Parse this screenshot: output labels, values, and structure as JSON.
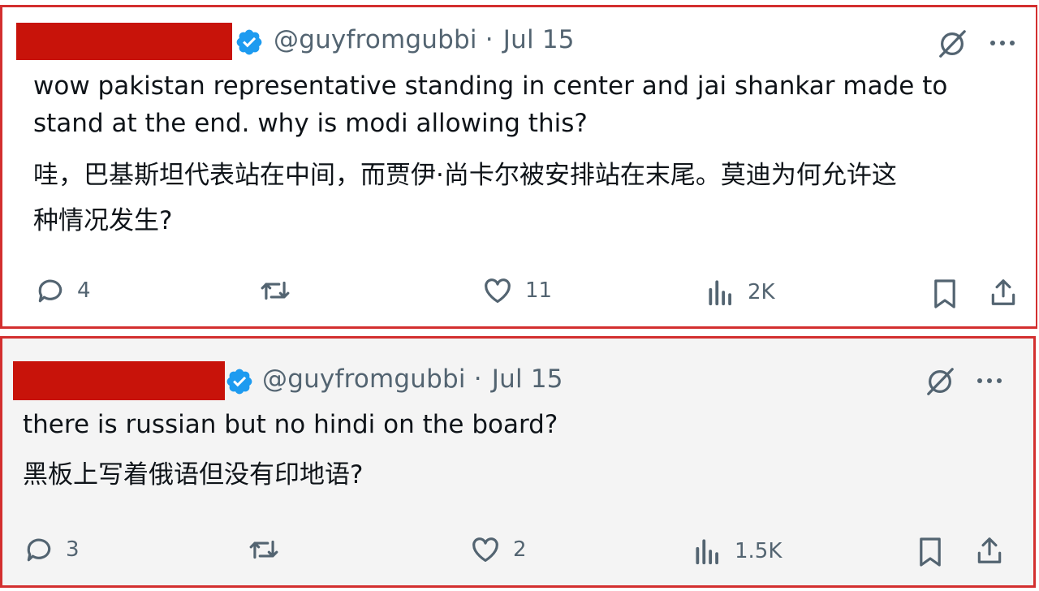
{
  "posts": [
    {
      "handle": "@guyfromgubbi",
      "separator": "·",
      "date": "Jul 15",
      "text_lines": [
        "wow pakistan representative standing in center and jai shankar made to",
        "stand at the end. why is modi allowing this?"
      ],
      "translation_lines": [
        "哇，巴基斯坦代表站在中间，而贾伊·尚卡尔被安排站在末尾。莫迪为何允许这",
        "种情况发生?"
      ],
      "replies": "4",
      "likes": "11",
      "views": "2K"
    },
    {
      "handle": "@guyfromgubbi",
      "separator": "·",
      "date": "Jul 15",
      "text_lines": [
        "there is russian but no hindi on the board?"
      ],
      "translation_lines": [
        "黑板上写着俄语但没有印地语?"
      ],
      "replies": "3",
      "likes": "2",
      "views": "1.5K"
    }
  ],
  "colors": {
    "border": "#d32f2f",
    "redaction": "#c8130a",
    "verified": "#1d9bf0",
    "muted": "#536471"
  },
  "icons": [
    "verified-badge-icon",
    "grok-icon",
    "more-icon",
    "reply-icon",
    "repost-icon",
    "like-icon",
    "views-icon",
    "bookmark-icon",
    "share-icon"
  ]
}
